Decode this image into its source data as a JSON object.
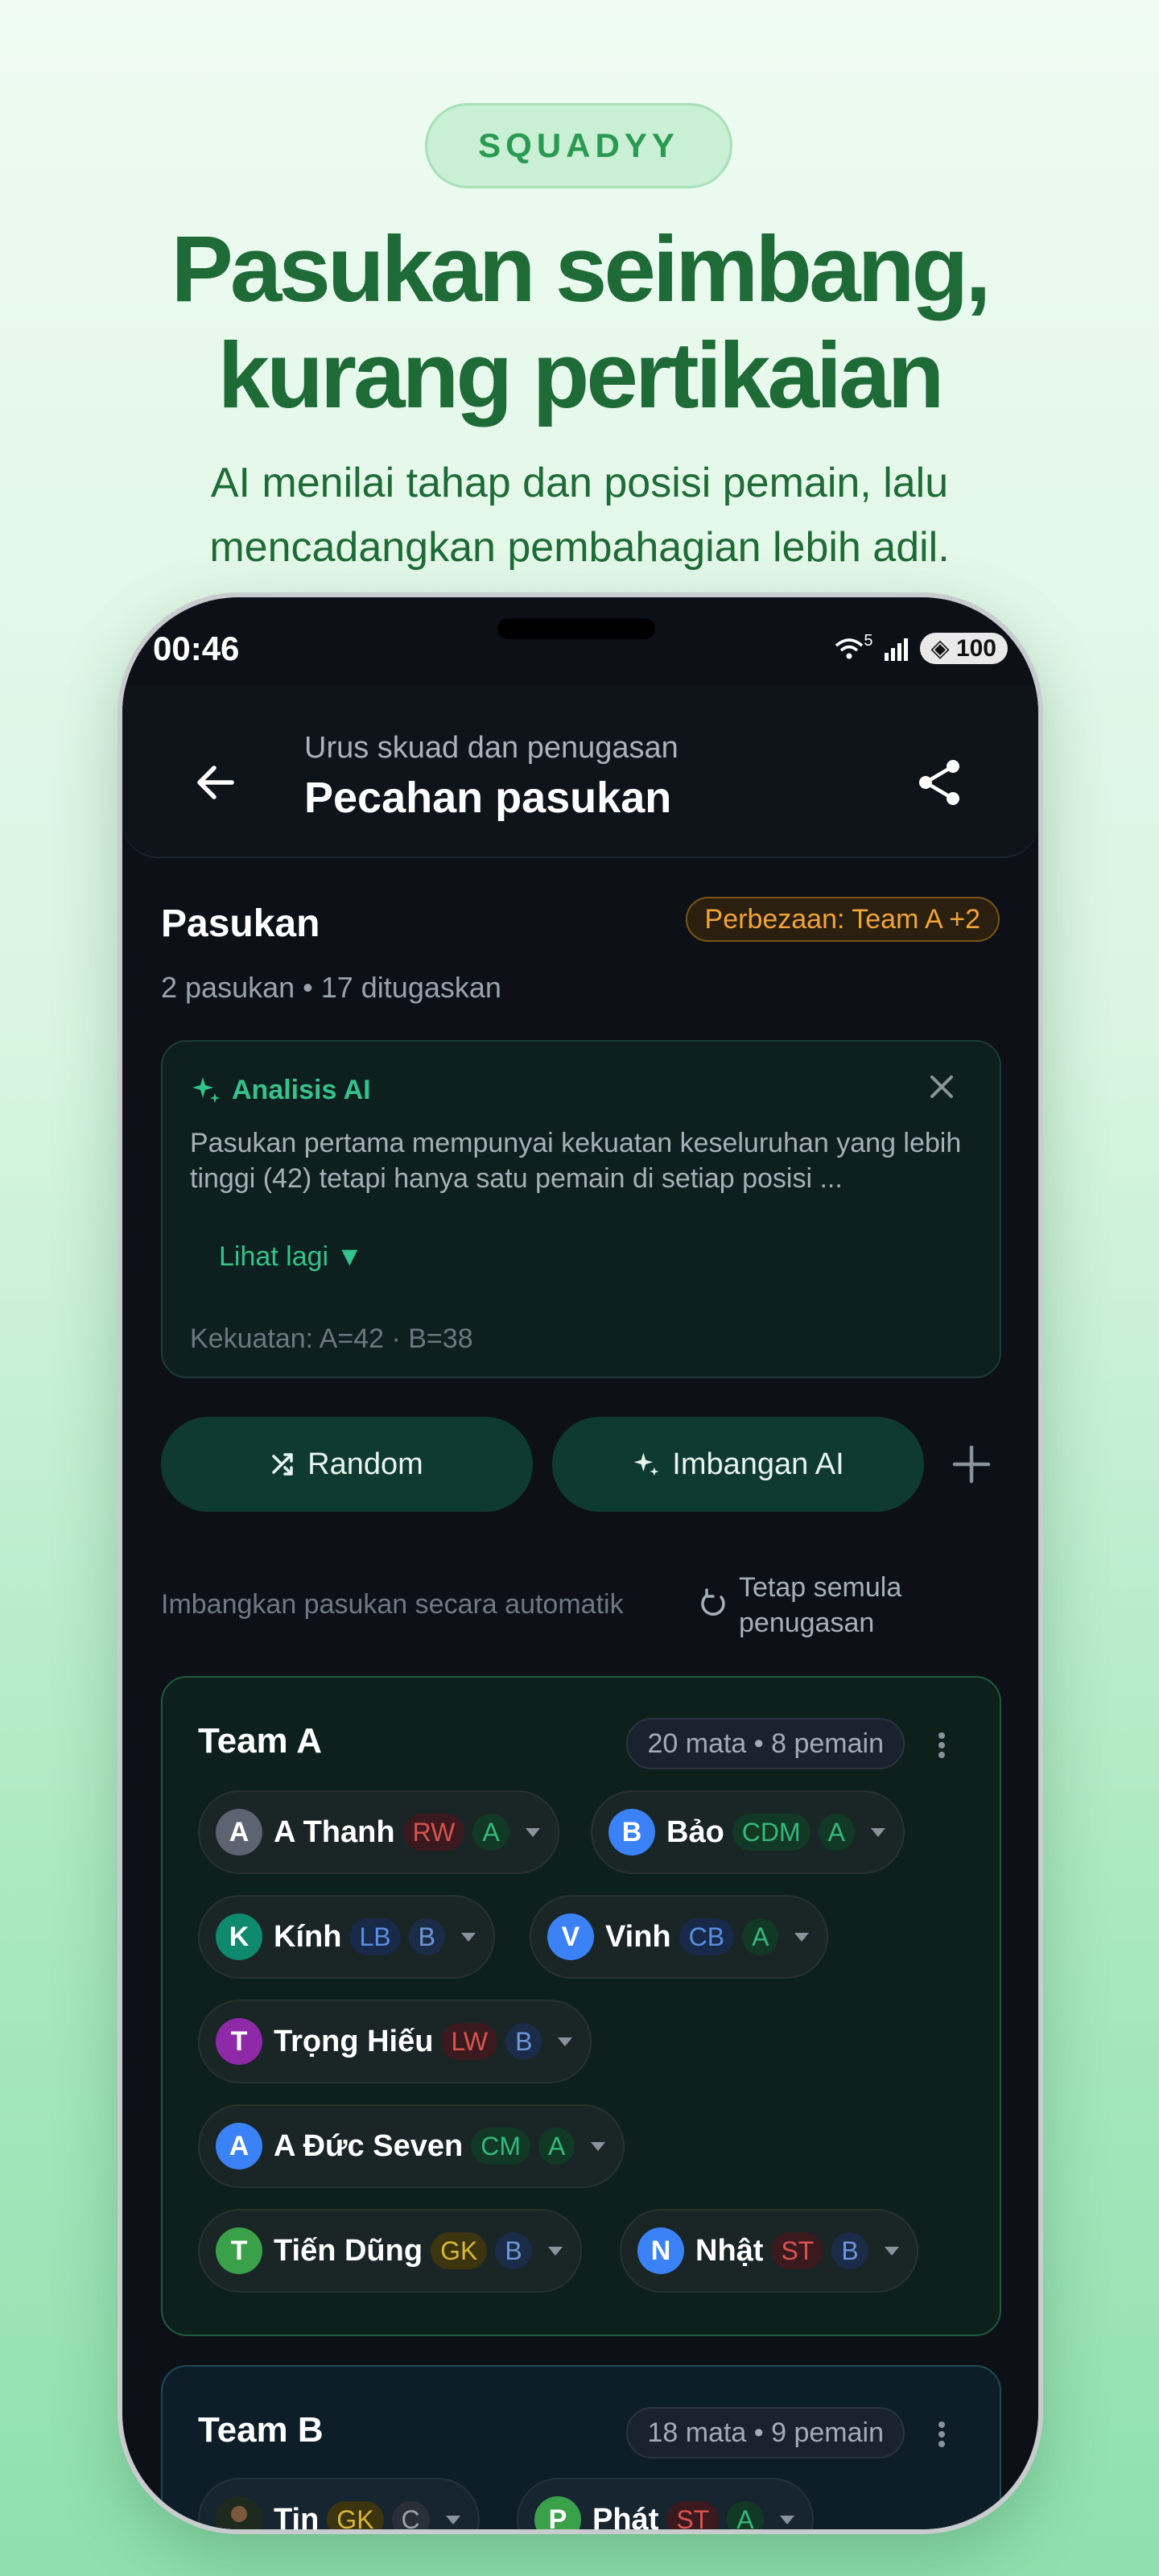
{
  "marketing": {
    "badge": "SQUADYY",
    "headline_line1": "Pasukan seimbang,",
    "headline_line2": "kurang pertikaian",
    "subline_line1": "AI menilai tahap dan posisi pemain, lalu",
    "subline_line2": "mencadangkan pembahagian lebih adil."
  },
  "status_bar": {
    "time": "00:46",
    "wifi_badge": "5",
    "battery": "100"
  },
  "appbar": {
    "subtitle": "Urus skuad dan penugasan",
    "title": "Pecahan pasukan",
    "icons": [
      "arrow-left-icon",
      "share-icon"
    ]
  },
  "section": {
    "title": "Pasukan",
    "difference_badge": "Perbezaan: Team A +2",
    "meta": "2 pasukan • 17 ditugaskan"
  },
  "ai_card": {
    "title": "Analisis AI",
    "text": "Pasukan pertama mempunyai kekuatan keseluruhan yang lebih tinggi (42) tetapi hanya satu pemain di setiap posisi ...",
    "more": "Lihat lagi ▼",
    "strength": "Kekuatan: A=42 · B=38"
  },
  "actions": {
    "random": "Random",
    "ai_balance": "Imbangan AI",
    "auto_text": "Imbangkan pasukan secara automatik",
    "reset_line1": "Tetap semula",
    "reset_line2": "penugasan"
  },
  "colors": {
    "accent_green": "#34c38a",
    "warning_orange": "#f2a43a",
    "background_dark": "#0d1117"
  },
  "teams": [
    {
      "name": "Team A",
      "stats": "20 mata • 8 pemain",
      "players": [
        {
          "initial": "A",
          "name": "A Thanh",
          "pos": "RW",
          "level": "A",
          "avatar_color": "#5b6470"
        },
        {
          "initial": "B",
          "name": "Bảo",
          "pos": "CDM",
          "level": "A",
          "avatar_color": "#3b82f6"
        },
        {
          "initial": "K",
          "name": "Kính",
          "pos": "LB",
          "level": "B",
          "avatar_color": "#0f8a6e"
        },
        {
          "initial": "V",
          "name": "Vinh",
          "pos": "CB",
          "level": "A",
          "avatar_color": "#3b82f6"
        },
        {
          "initial": "T",
          "name": "Trọng Hiếu",
          "pos": "LW",
          "level": "B",
          "avatar_color": "#8e2aa8"
        },
        {
          "initial": "A",
          "name": "A Đức Seven",
          "pos": "CM",
          "level": "A",
          "avatar_color": "#3b82f6"
        },
        {
          "initial": "T",
          "name": "Tiến Dũng",
          "pos": "GK",
          "level": "B",
          "avatar_color": "#3aa04a"
        },
        {
          "initial": "N",
          "name": "Nhật",
          "pos": "ST",
          "level": "B",
          "avatar_color": "#3b82f6"
        }
      ]
    },
    {
      "name": "Team B",
      "stats": "18 mata • 9 pemain",
      "players": [
        {
          "initial": "",
          "name": "Tin",
          "pos": "GK",
          "level": "C",
          "avatar_color": "#1f2a1f"
        },
        {
          "initial": "P",
          "name": "Phát",
          "pos": "ST",
          "level": "A",
          "avatar_color": "#3aa04a"
        }
      ]
    }
  ]
}
